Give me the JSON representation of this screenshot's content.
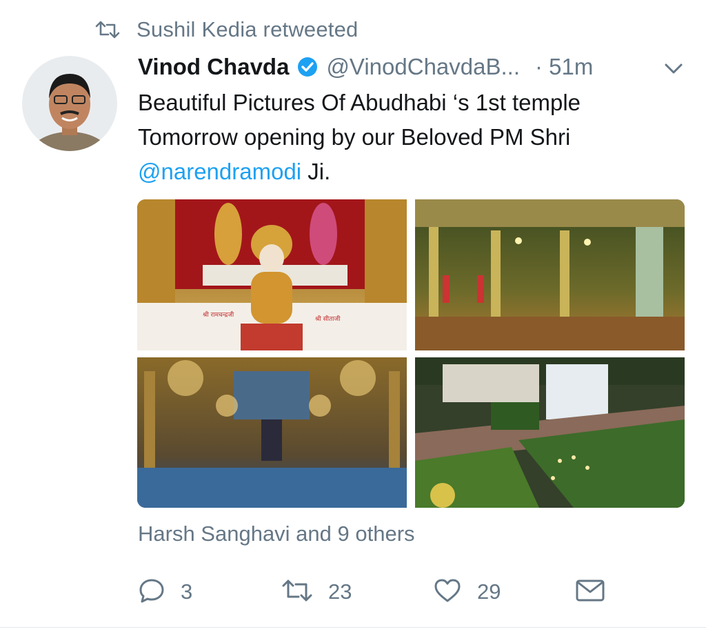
{
  "retweet": {
    "text": "Sushil Kedia retweeted",
    "icon": "retweet-icon"
  },
  "author": {
    "name": "Vinod Chavda",
    "handle": "@VinodChavdaB...",
    "time": "· 51m",
    "verified": true,
    "avatar": "avatar-photo"
  },
  "tweet": {
    "line1": "Beautiful Pictures Of Abudhabi ‘s 1st temple",
    "line2": "Tomorrow opening by our Beloved PM Shri",
    "mention": "@narendramodi",
    "line3_suffix": " Ji."
  },
  "media": {
    "images": [
      "temple-idol-photo",
      "temple-interior-photo",
      "palace-hall-photo",
      "temple-aerial-photo"
    ],
    "caption_marks": [
      "श्री रामचन्द्रजी",
      "श्री सीताजी"
    ]
  },
  "likers": "Harsh Sanghavi and 9 others",
  "actions": {
    "reply_count": "3",
    "retweet_count": "23",
    "like_count": "29"
  },
  "colors": {
    "accent": "#1da1f2",
    "muted": "#657786",
    "text": "#14171a"
  }
}
